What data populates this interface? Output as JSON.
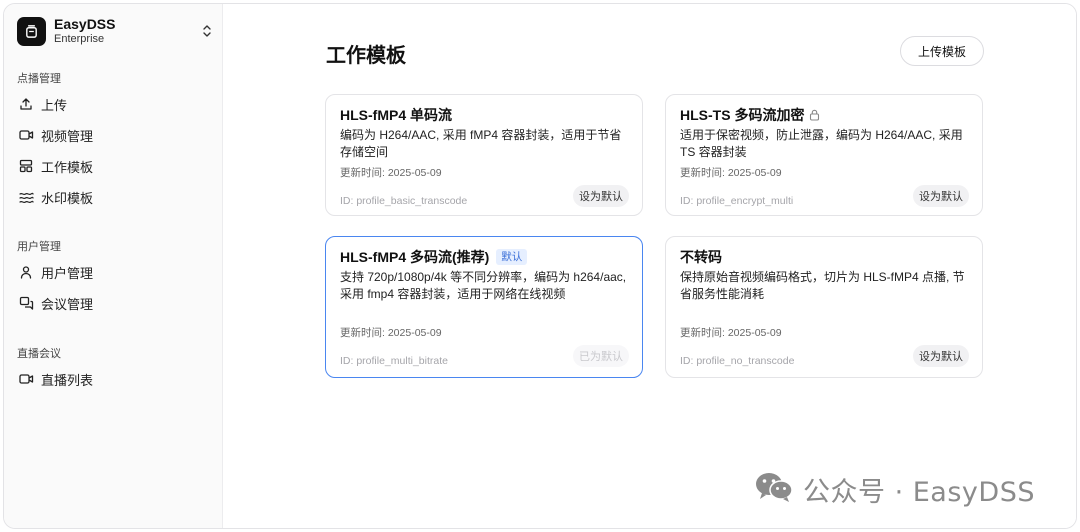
{
  "brand": {
    "name": "EasyDSS",
    "plan": "Enterprise"
  },
  "sidebar": {
    "groups": [
      {
        "title": "点播管理",
        "items": [
          {
            "label": "上传",
            "icon": "upload-icon"
          },
          {
            "label": "视频管理",
            "icon": "video-icon"
          },
          {
            "label": "工作模板",
            "icon": "template-icon"
          },
          {
            "label": "水印模板",
            "icon": "watermark-icon"
          }
        ]
      },
      {
        "title": "用户管理",
        "items": [
          {
            "label": "用户管理",
            "icon": "user-icon"
          },
          {
            "label": "会议管理",
            "icon": "meeting-icon"
          }
        ]
      },
      {
        "title": "直播会议",
        "items": [
          {
            "label": "直播列表",
            "icon": "live-icon"
          }
        ]
      }
    ]
  },
  "main": {
    "title": "工作模板",
    "upload_label": "上传模板",
    "cards": [
      {
        "title": "HLS-fMP4 单码流",
        "desc": "编码为 H264/AAC, 采用 fMP4 容器封装，适用于节省存储空间",
        "date": "更新时间: 2025-05-09",
        "id": "ID: profile_basic_transcode",
        "action": "设为默认"
      },
      {
        "title": "HLS-TS 多码流加密",
        "locked": true,
        "desc": "适用于保密视频，防止泄露，编码为 H264/AAC, 采用 TS 容器封装",
        "date": "更新时间: 2025-05-09",
        "id": "ID: profile_encrypt_multi",
        "action": "设为默认"
      },
      {
        "title": "HLS-fMP4 多码流(推荐)",
        "badge": "默认",
        "active": true,
        "desc": "支持 720p/1080p/4k 等不同分辨率，编码为 h264/aac, 采用 fmp4 容器封装，适用于网络在线视频",
        "date": "更新时间: 2025-05-09",
        "id": "ID: profile_multi_bitrate",
        "action": "已为默认"
      },
      {
        "title": "不转码",
        "desc": "保持原始音视频编码格式，切片为 HLS-fMP4 点播, 节省服务性能消耗",
        "date": "更新时间: 2025-05-09",
        "id": "ID: profile_no_transcode",
        "action": "设为默认"
      }
    ]
  },
  "watermark": {
    "text": "公众号 · EasyDSS"
  },
  "colors": {
    "accent": "#4a86f0",
    "badge_bg": "#e6efff",
    "badge_text": "#3b6fd8"
  }
}
